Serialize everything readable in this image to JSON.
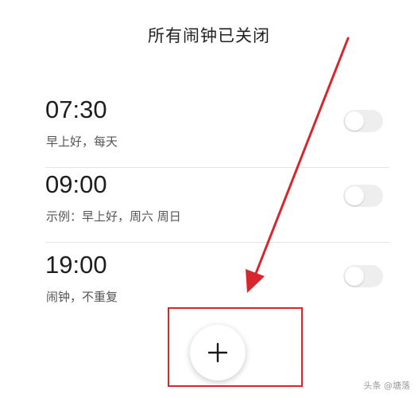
{
  "header": {
    "title": "所有闹钟已关闭"
  },
  "alarms": [
    {
      "time": "07:30",
      "label": "早上好，每天",
      "enabled": false
    },
    {
      "time": "09:00",
      "label": "示例：早上好，周六 周日",
      "enabled": false
    },
    {
      "time": "19:00",
      "label": "闹钟，不重复",
      "enabled": false
    }
  ],
  "add_button": {
    "icon": "plus-icon"
  },
  "annotation": {
    "color": "#d7262d",
    "arrow_icon": "arrow-icon"
  },
  "watermark": "头条 @塘落"
}
